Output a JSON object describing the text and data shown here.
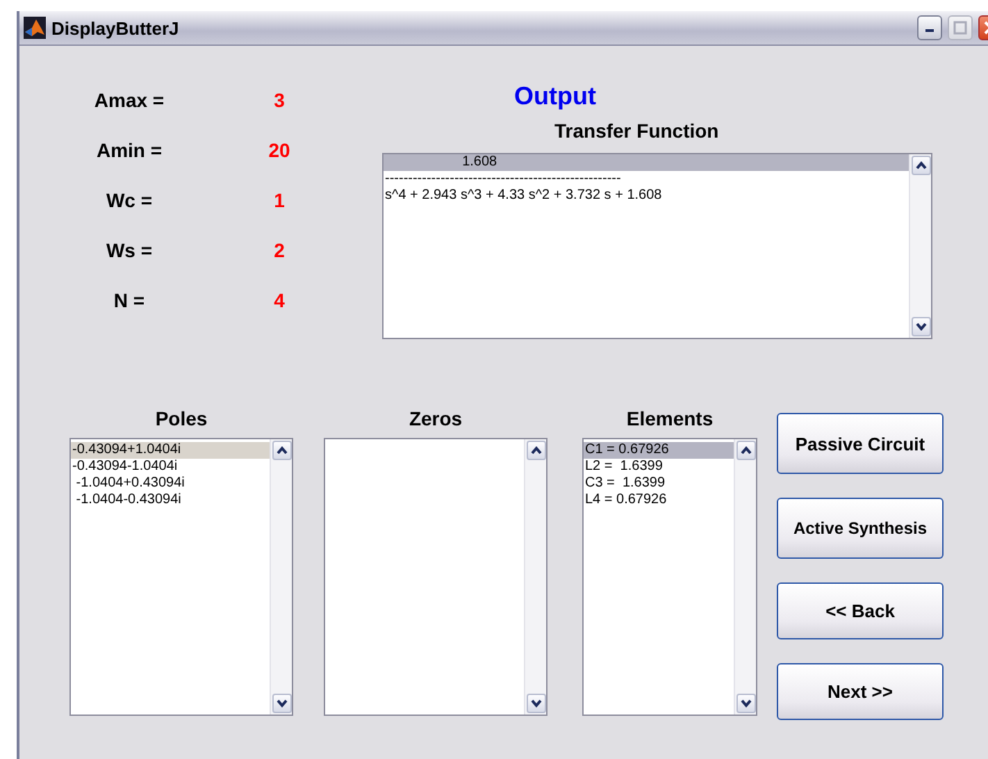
{
  "window": {
    "title": "DisplayButterJ"
  },
  "parameters": [
    {
      "label": "Amax =",
      "value": "3"
    },
    {
      "label": "Amin =",
      "value": "20"
    },
    {
      "label": "Wc =",
      "value": "1"
    },
    {
      "label": "Ws =",
      "value": "2"
    },
    {
      "label": "N =",
      "value": "4"
    }
  ],
  "output": {
    "title": "Output",
    "subtitle": "Transfer Function",
    "lines": [
      {
        "text": "                    1.608",
        "selected": true
      },
      {
        "text": "---------------------------------------------------",
        "selected": false
      },
      {
        "text": "s^4 + 2.943 s^3 + 4.33 s^2 + 3.732 s + 1.608",
        "selected": false
      }
    ]
  },
  "lists": [
    {
      "title": "Poles",
      "items": [
        {
          "text": "-0.43094+1.0404i",
          "selected": true
        },
        {
          "text": "-0.43094-1.0404i",
          "selected": false
        },
        {
          "text": " -1.0404+0.43094i",
          "selected": false
        },
        {
          "text": " -1.0404-0.43094i",
          "selected": false
        }
      ]
    },
    {
      "title": "Zeros"
    },
    {
      "title": "Elements",
      "items": [
        {
          "text": "C1 = 0.67926",
          "selected": true
        },
        {
          "text": "L2 =  1.6399",
          "selected": false
        },
        {
          "text": "C3 =  1.6399",
          "selected": false
        },
        {
          "text": "L4 = 0.67926",
          "selected": false
        }
      ]
    }
  ],
  "buttons": [
    "Passive Circuit",
    "Active Synthesis",
    "<< Back",
    "Next >>"
  ]
}
